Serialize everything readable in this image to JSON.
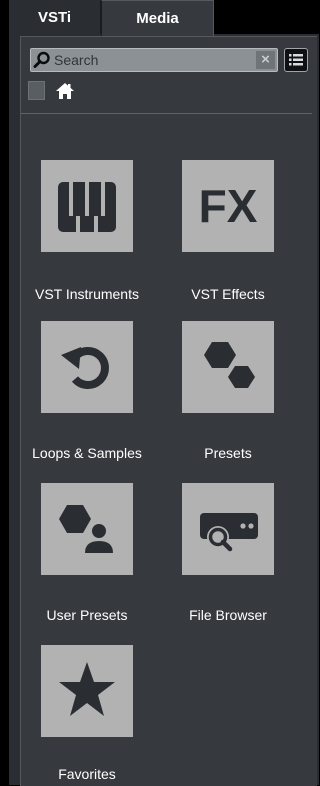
{
  "tabs": {
    "vsti": "VSTi",
    "media": "Media"
  },
  "search": {
    "placeholder": "Search",
    "clear_icon": "×"
  },
  "nav": {
    "back_icon": "back-arrow",
    "home_icon": "home"
  },
  "tiles": [
    {
      "label": "VST Instruments",
      "icon": "piano-keys"
    },
    {
      "label": "VST Effects",
      "icon": "fx"
    },
    {
      "label": "Loops & Samples",
      "icon": "loop-arrow"
    },
    {
      "label": "Presets",
      "icon": "hexagons"
    },
    {
      "label": "User Presets",
      "icon": "hexagon-user"
    },
    {
      "label": "File Browser",
      "icon": "drive-search"
    },
    {
      "label": "Favorites",
      "icon": "star"
    }
  ],
  "icon_texts": {
    "fx": "FX"
  },
  "colors": {
    "tile": "#b2b2b2",
    "glyph": "#2a2d31",
    "panel": "#363a3f",
    "tab_bar": "#000000"
  }
}
